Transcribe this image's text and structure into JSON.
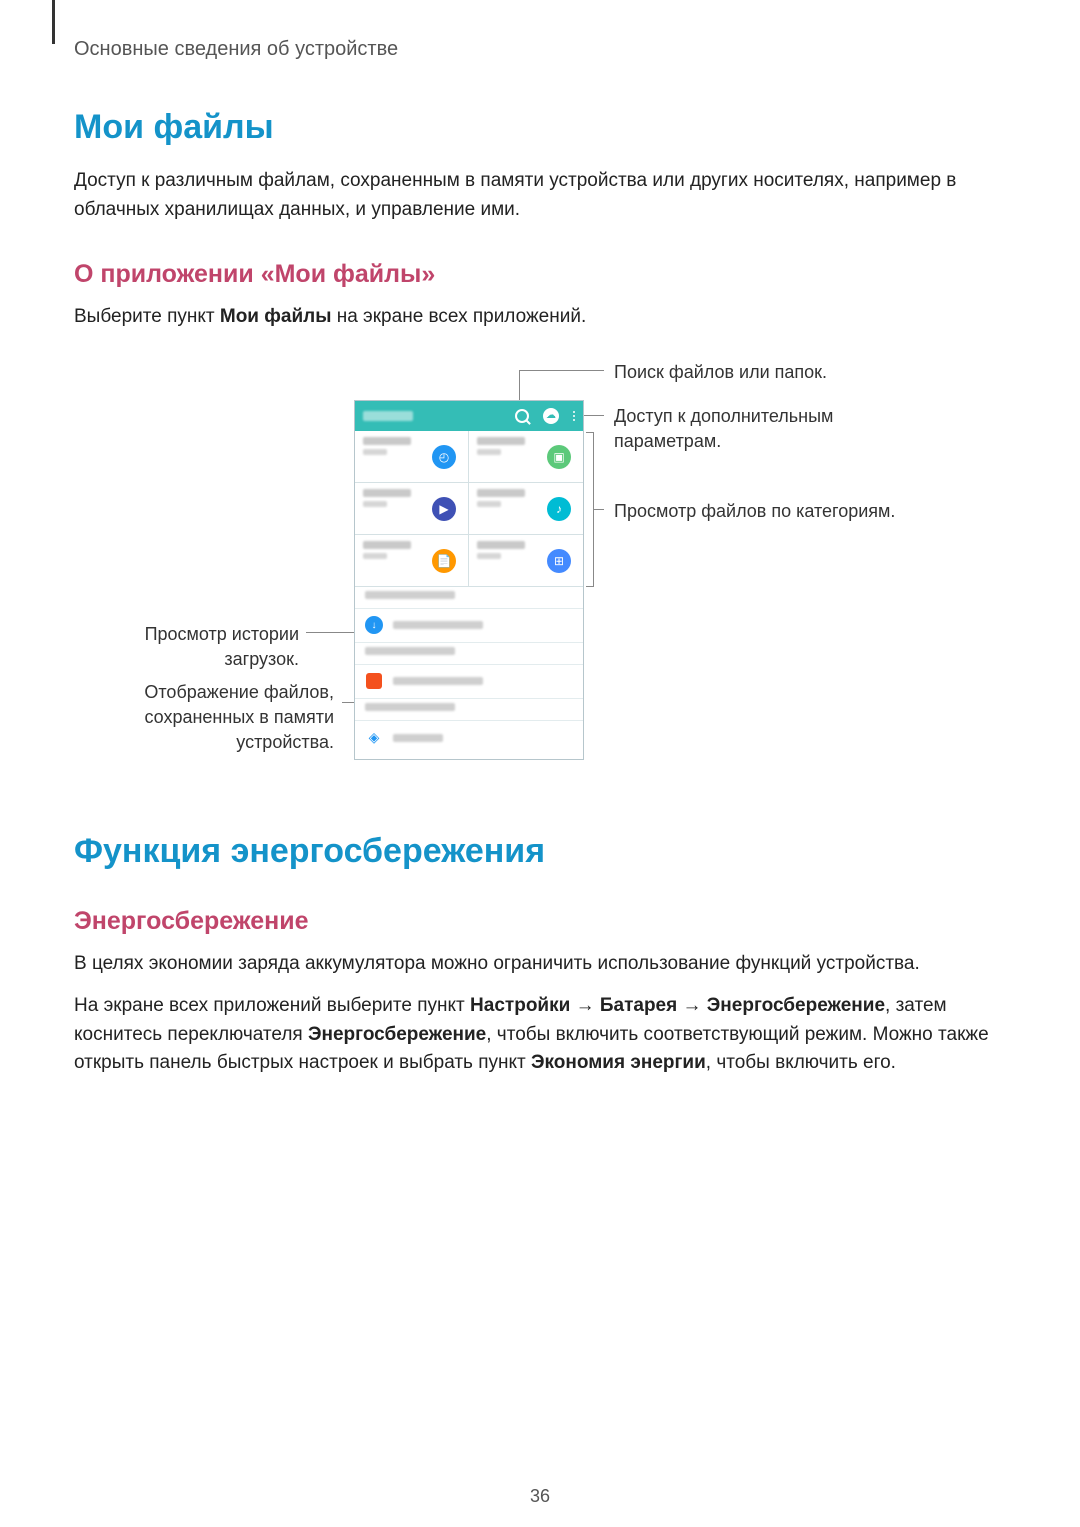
{
  "header": {
    "breadcrumb": "Основные сведения об устройстве"
  },
  "page_number": "36",
  "section1": {
    "title": "Мои файлы",
    "intro": "Доступ к различным файлам, сохраненным в памяти устройства или других носителях, например в облачных хранилищах данных, и управление ими.",
    "subheading": "О приложении «Мои файлы»",
    "instruction_pre": "Выберите пункт ",
    "instruction_bold": "Мои файлы",
    "instruction_post": " на экране всех приложений."
  },
  "callouts": {
    "search": "Поиск файлов или папок.",
    "options": "Доступ к дополнительным параметрам.",
    "categories": "Просмотр файлов по категориям.",
    "download_history": "Просмотр истории загрузок.",
    "device_storage": "Отображение файлов, сохраненных в памяти устройства."
  },
  "section2": {
    "title": "Функция энергосбережения",
    "subheading": "Энергосбережение",
    "p1": "В целях экономии заряда аккумулятора можно ограничить использование функций устройства.",
    "p2_a": "На экране всех приложений выберите пункт ",
    "b1": "Настройки",
    "arr": " → ",
    "b2": "Батарея",
    "b3": "Энергосбережение",
    "p2_b": ", затем коснитесь переключателя ",
    "b4": "Энергосбережение",
    "p2_c": ", чтобы включить соответствующий режим. Можно также открыть панель быстрых настроек и выбрать пункт ",
    "b5": "Экономия энергии",
    "p2_d": ", чтобы включить его."
  }
}
